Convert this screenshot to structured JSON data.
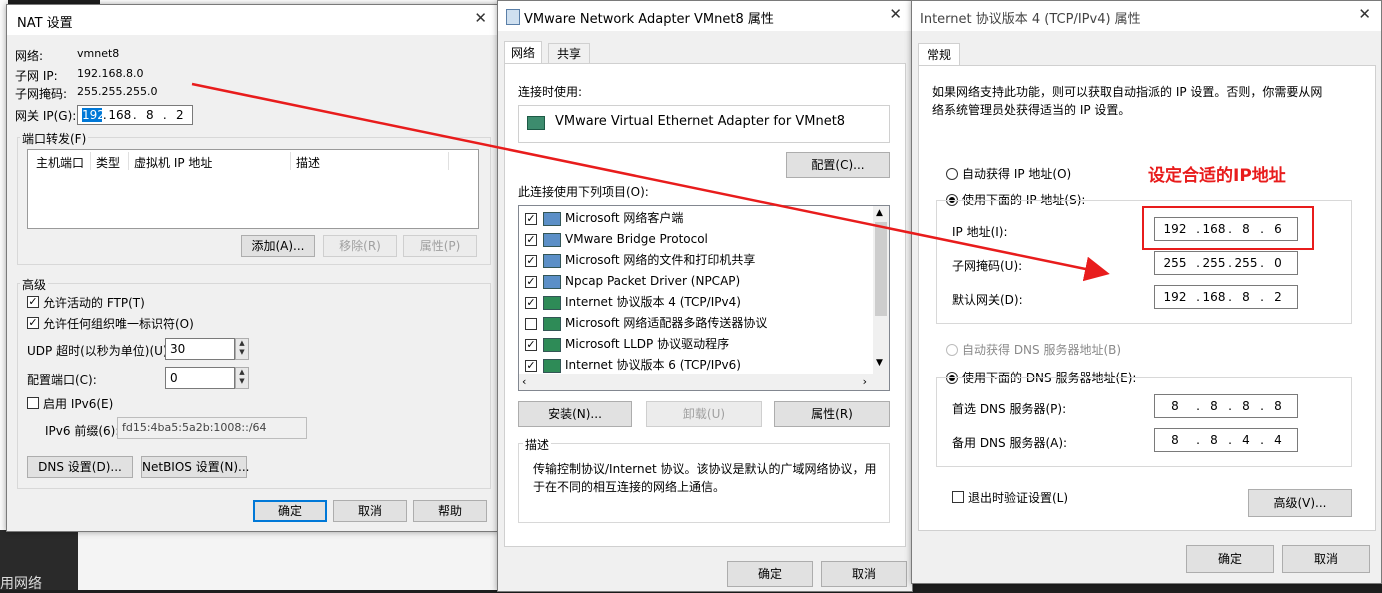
{
  "colors": {
    "accent": "#0078d7",
    "annotation": "#e81c1c",
    "background": "#1e1e1e"
  },
  "nat": {
    "title": "NAT 设置",
    "network_label": "网络:",
    "network_value": "vmnet8",
    "subnet_ip_label": "子网 IP:",
    "subnet_ip_value": "192.168.8.0",
    "subnet_mask_label": "子网掩码:",
    "subnet_mask_value": "255.255.255.0",
    "gateway_label": "网关 IP(G):",
    "gateway_octets": [
      "192",
      "168",
      "8",
      "2"
    ],
    "port_forwarding_label": "端口转发(F)",
    "columns": [
      "主机端口",
      "类型",
      "虚拟机 IP 地址",
      "描述"
    ],
    "add_btn": "添加(A)...",
    "remove_btn": "移除(R)",
    "props_btn": "属性(P)",
    "advanced_label": "高级",
    "allow_ftp": "允许活动的 FTP(T)",
    "allow_uid": "允许任何组织唯一标识符(O)",
    "udp_timeout_label": "UDP 超时(以秒为单位)(U):",
    "udp_timeout_value": "30",
    "config_port_label": "配置端口(C):",
    "config_port_value": "0",
    "enable_ipv6": "启用 IPv6(E)",
    "ipv6_prefix_label": "IPv6 前缀(6):",
    "ipv6_prefix_value": "fd15:4ba5:5a2b:1008::/64",
    "dns_btn": "DNS 设置(D)...",
    "netbios_btn": "NetBIOS 设置(N)...",
    "ok_btn": "确定",
    "cancel_btn": "取消",
    "help_btn": "帮助"
  },
  "adapter": {
    "title": "VMware Network Adapter VMnet8 属性",
    "tabs": [
      "网络",
      "共享"
    ],
    "connect_using_label": "连接时使用:",
    "adapter_name": "VMware Virtual Ethernet Adapter for VMnet8",
    "configure_btn": "配置(C)...",
    "items_label": "此连接使用下列项目(O):",
    "items": [
      {
        "label": "Microsoft 网络客户端",
        "checked": true
      },
      {
        "label": "VMware Bridge Protocol",
        "checked": true
      },
      {
        "label": "Microsoft 网络的文件和打印机共享",
        "checked": true
      },
      {
        "label": "Npcap Packet Driver (NPCAP)",
        "checked": true
      },
      {
        "label": "Internet 协议版本 4 (TCP/IPv4)",
        "checked": true
      },
      {
        "label": "Microsoft 网络适配器多路传送器协议",
        "checked": false
      },
      {
        "label": "Microsoft LLDP 协议驱动程序",
        "checked": true
      },
      {
        "label": "Internet 协议版本 6 (TCP/IPv6)",
        "checked": true
      }
    ],
    "install_btn": "安装(N)...",
    "uninstall_btn": "卸载(U)",
    "properties_btn": "属性(R)",
    "description_label": "描述",
    "description_text": "传输控制协议/Internet 协议。该协议是默认的广域网络协议，用于在不同的相互连接的网络上通信。",
    "ok_btn": "确定",
    "cancel_btn": "取消"
  },
  "ipv4": {
    "title": "Internet 协议版本 4 (TCP/IPv4) 属性",
    "tab": "常规",
    "intro": "如果网络支持此功能，则可以获取自动指派的 IP 设置。否则，你需要从网络系统管理员处获得适当的 IP 设置。",
    "auto_ip": "自动获得 IP 地址(O)",
    "manual_ip": "使用下面的 IP 地址(S):",
    "ip_label": "IP 地址(I):",
    "ip_octets": [
      "192",
      "168",
      "8",
      "6"
    ],
    "mask_label": "子网掩码(U):",
    "mask_octets": [
      "255",
      "255",
      "255",
      "0"
    ],
    "gw_label": "默认网关(D):",
    "gw_octets": [
      "192",
      "168",
      "8",
      "2"
    ],
    "auto_dns": "自动获得 DNS 服务器地址(B)",
    "manual_dns": "使用下面的 DNS 服务器地址(E):",
    "pref_dns_label": "首选 DNS 服务器(P):",
    "pref_dns_octets": [
      "8",
      "8",
      "8",
      "8"
    ],
    "alt_dns_label": "备用 DNS 服务器(A):",
    "alt_dns_octets": [
      "8",
      "8",
      "4",
      "4"
    ],
    "validate": "退出时验证设置(L)",
    "advanced_btn": "高级(V)...",
    "ok_btn": "确定",
    "cancel_btn": "取消",
    "annotation": "设定合适的IP地址"
  },
  "background": {
    "partial_text": "用网络"
  }
}
